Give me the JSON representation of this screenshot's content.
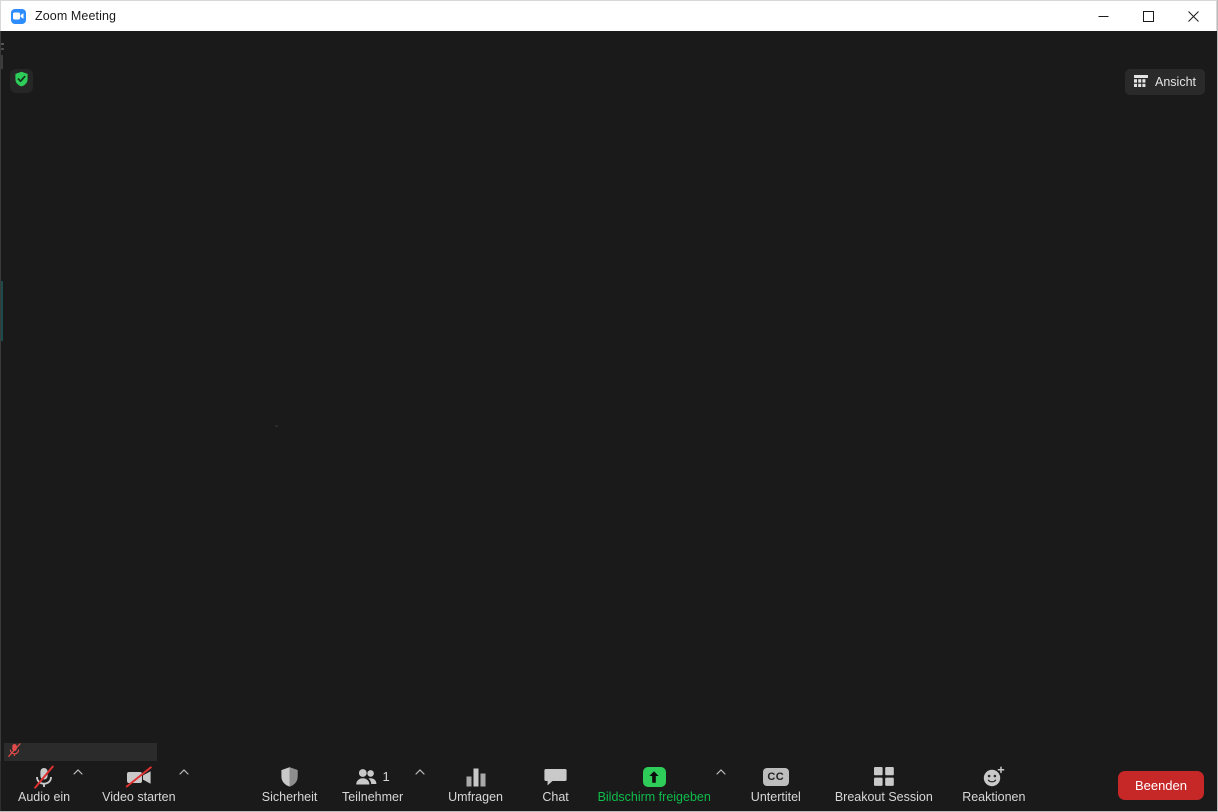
{
  "window": {
    "title": "Zoom Meeting",
    "app_icon": "zoom-camera-icon",
    "controls": {
      "minimize": "minimize-icon",
      "maximize": "maximize-icon",
      "close": "close-icon"
    }
  },
  "stage": {
    "security_badge_icon": "shield-check-icon",
    "view_button": {
      "label": "Ansicht",
      "icon": "grid-view-icon"
    },
    "selfview": {
      "mic_icon": "microphone-muted-icon",
      "mic_color": "#e04a4a"
    },
    "background_color": "#1a1a1a"
  },
  "toolbar": {
    "items": [
      {
        "name": "audio",
        "label": "Audio ein",
        "icon": "microphone-muted-icon",
        "caret": true,
        "badge": null,
        "color": "#d7d7d7"
      },
      {
        "name": "video",
        "label": "Video starten",
        "icon": "video-camera-off-icon",
        "caret": true,
        "badge": null,
        "color": "#d7d7d7"
      },
      {
        "name": "security",
        "label": "Sicherheit",
        "icon": "shield-icon",
        "caret": false,
        "badge": null,
        "color": "#d7d7d7"
      },
      {
        "name": "participants",
        "label": "Teilnehmer",
        "icon": "people-icon",
        "caret": true,
        "badge": "1",
        "color": "#d7d7d7"
      },
      {
        "name": "polls",
        "label": "Umfragen",
        "icon": "bar-chart-icon",
        "caret": false,
        "badge": null,
        "color": "#d7d7d7"
      },
      {
        "name": "chat",
        "label": "Chat",
        "icon": "chat-bubble-icon",
        "caret": false,
        "badge": null,
        "color": "#d7d7d7"
      },
      {
        "name": "share",
        "label": "Bildschirm freigeben",
        "icon": "share-screen-up-arrow-icon",
        "caret": true,
        "badge": null,
        "color": "#0fbd4b"
      },
      {
        "name": "captions",
        "label": "Untertitel",
        "icon": "closed-captions-icon",
        "caret": false,
        "badge": "CC",
        "color": "#d7d7d7"
      },
      {
        "name": "breakout",
        "label": "Breakout Session",
        "icon": "grid-squares-icon",
        "caret": false,
        "badge": null,
        "color": "#d7d7d7"
      },
      {
        "name": "reactions",
        "label": "Reaktionen",
        "icon": "smiley-plus-icon",
        "caret": false,
        "badge": null,
        "color": "#d7d7d7"
      }
    ],
    "leave_button": {
      "label": "Beenden",
      "color": "#c62828"
    }
  },
  "colors": {
    "background": "#1a1a1a",
    "titlebar": "#ffffff",
    "accent_blue": "#2d8cff",
    "accent_green": "#2ecc58",
    "label_text": "#d7d7d7",
    "leave_red": "#c62828",
    "mute_red": "#e04a4a"
  }
}
